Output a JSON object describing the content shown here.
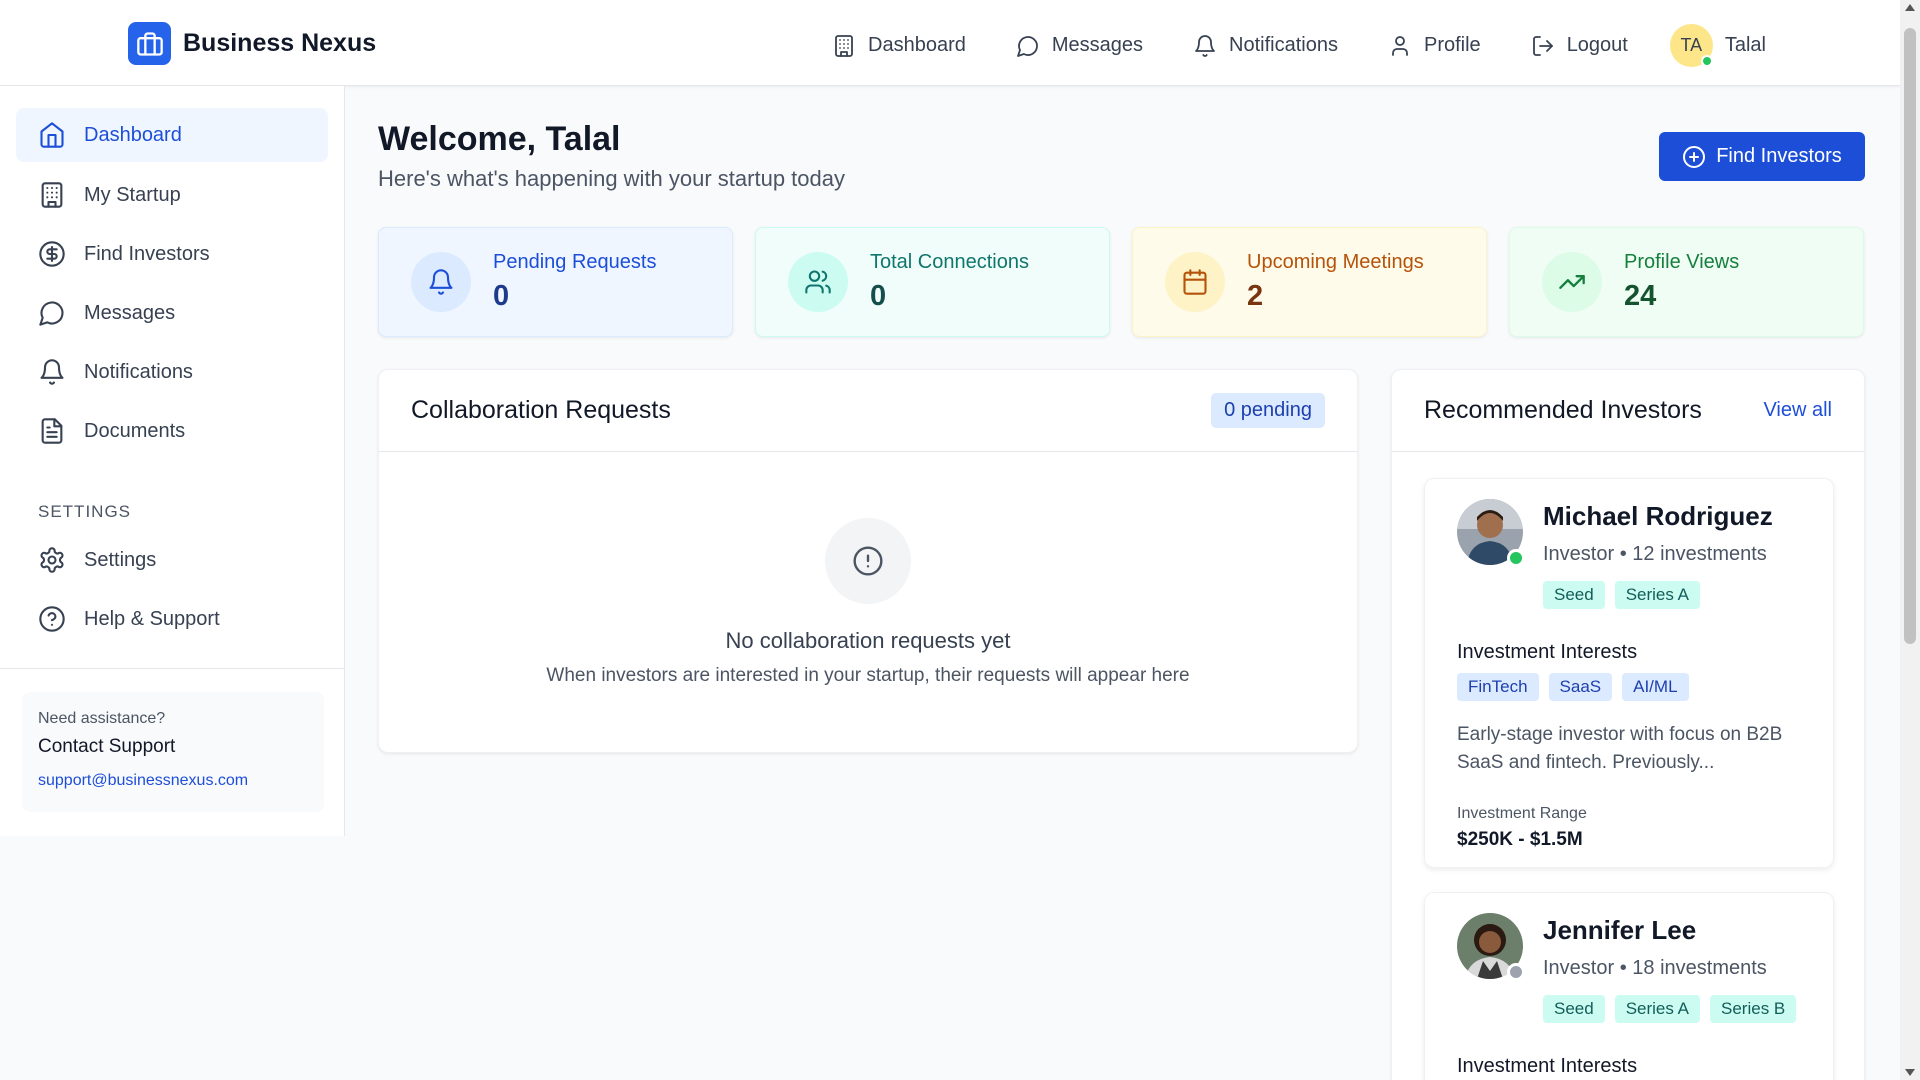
{
  "brand": {
    "name": "Business Nexus",
    "icon": "briefcase-icon",
    "color": "#2563eb"
  },
  "topnav": {
    "items": [
      {
        "label": "Dashboard",
        "icon": "building-icon"
      },
      {
        "label": "Messages",
        "icon": "chat-bubble-icon"
      },
      {
        "label": "Notifications",
        "icon": "bell-icon"
      },
      {
        "label": "Profile",
        "icon": "user-icon"
      },
      {
        "label": "Logout",
        "icon": "logout-icon"
      }
    ],
    "user": {
      "initials": "TA",
      "name": "Talal",
      "status": "online"
    }
  },
  "sidebar": {
    "items": [
      {
        "label": "Dashboard",
        "icon": "home-icon",
        "active": true
      },
      {
        "label": "My Startup",
        "icon": "building-icon"
      },
      {
        "label": "Find Investors",
        "icon": "dollar-circle-icon"
      },
      {
        "label": "Messages",
        "icon": "chat-bubble-icon"
      },
      {
        "label": "Notifications",
        "icon": "bell-icon"
      },
      {
        "label": "Documents",
        "icon": "document-icon"
      }
    ],
    "settings_heading": "SETTINGS",
    "settings_items": [
      {
        "label": "Settings",
        "icon": "gear-icon"
      },
      {
        "label": "Help & Support",
        "icon": "help-circle-icon"
      }
    ],
    "support": {
      "need": "Need assistance?",
      "title": "Contact Support",
      "email": "support@businessnexus.com"
    }
  },
  "main": {
    "welcome": "Welcome, Talal",
    "subtitle": "Here's what's happening with your startup today",
    "find_button": "Find Investors",
    "stats": [
      {
        "label": "Pending Requests",
        "value": "0",
        "icon": "bell-icon",
        "bg": "#eff6ff",
        "iconbg": "#dbeafe",
        "color": "#1d4ed8",
        "valcolor": "#1e3a8a"
      },
      {
        "label": "Total Connections",
        "value": "0",
        "icon": "users-icon",
        "bg": "#f0fdfa",
        "iconbg": "#ccfbf1",
        "color": "#0f766e",
        "valcolor": "#134e4a"
      },
      {
        "label": "Upcoming Meetings",
        "value": "2",
        "icon": "calendar-icon",
        "bg": "#fffbeb",
        "iconbg": "#fef3c7",
        "color": "#b45309",
        "valcolor": "#78350f"
      },
      {
        "label": "Profile Views",
        "value": "24",
        "icon": "trending-up-icon",
        "bg": "#f0fdf4",
        "iconbg": "#dcfce7",
        "color": "#15803d",
        "valcolor": "#14532d"
      }
    ]
  },
  "collab": {
    "title": "Collaboration Requests",
    "badge": "0 pending",
    "empty_title": "No collaboration requests yet",
    "empty_sub": "When investors are interested in your startup, their requests will appear here"
  },
  "recs": {
    "title": "Recommended Investors",
    "view_all": "View all",
    "investors": [
      {
        "name": "Michael Rodriguez",
        "role": "Investor",
        "investments": "12 investments",
        "stages": [
          "Seed",
          "Series A"
        ],
        "interests_label": "Investment Interests",
        "interests": [
          "FinTech",
          "SaaS",
          "AI/ML"
        ],
        "description": "Early-stage investor with focus on B2B SaaS and fintech. Previously...",
        "range_label": "Investment Range",
        "range": "$250K - $1.5M",
        "status": "online"
      },
      {
        "name": "Jennifer Lee",
        "role": "Investor",
        "investments": "18 investments",
        "stages": [
          "Seed",
          "Series A",
          "Series B"
        ],
        "interests_label": "Investment Interests",
        "status": "offline"
      }
    ]
  }
}
